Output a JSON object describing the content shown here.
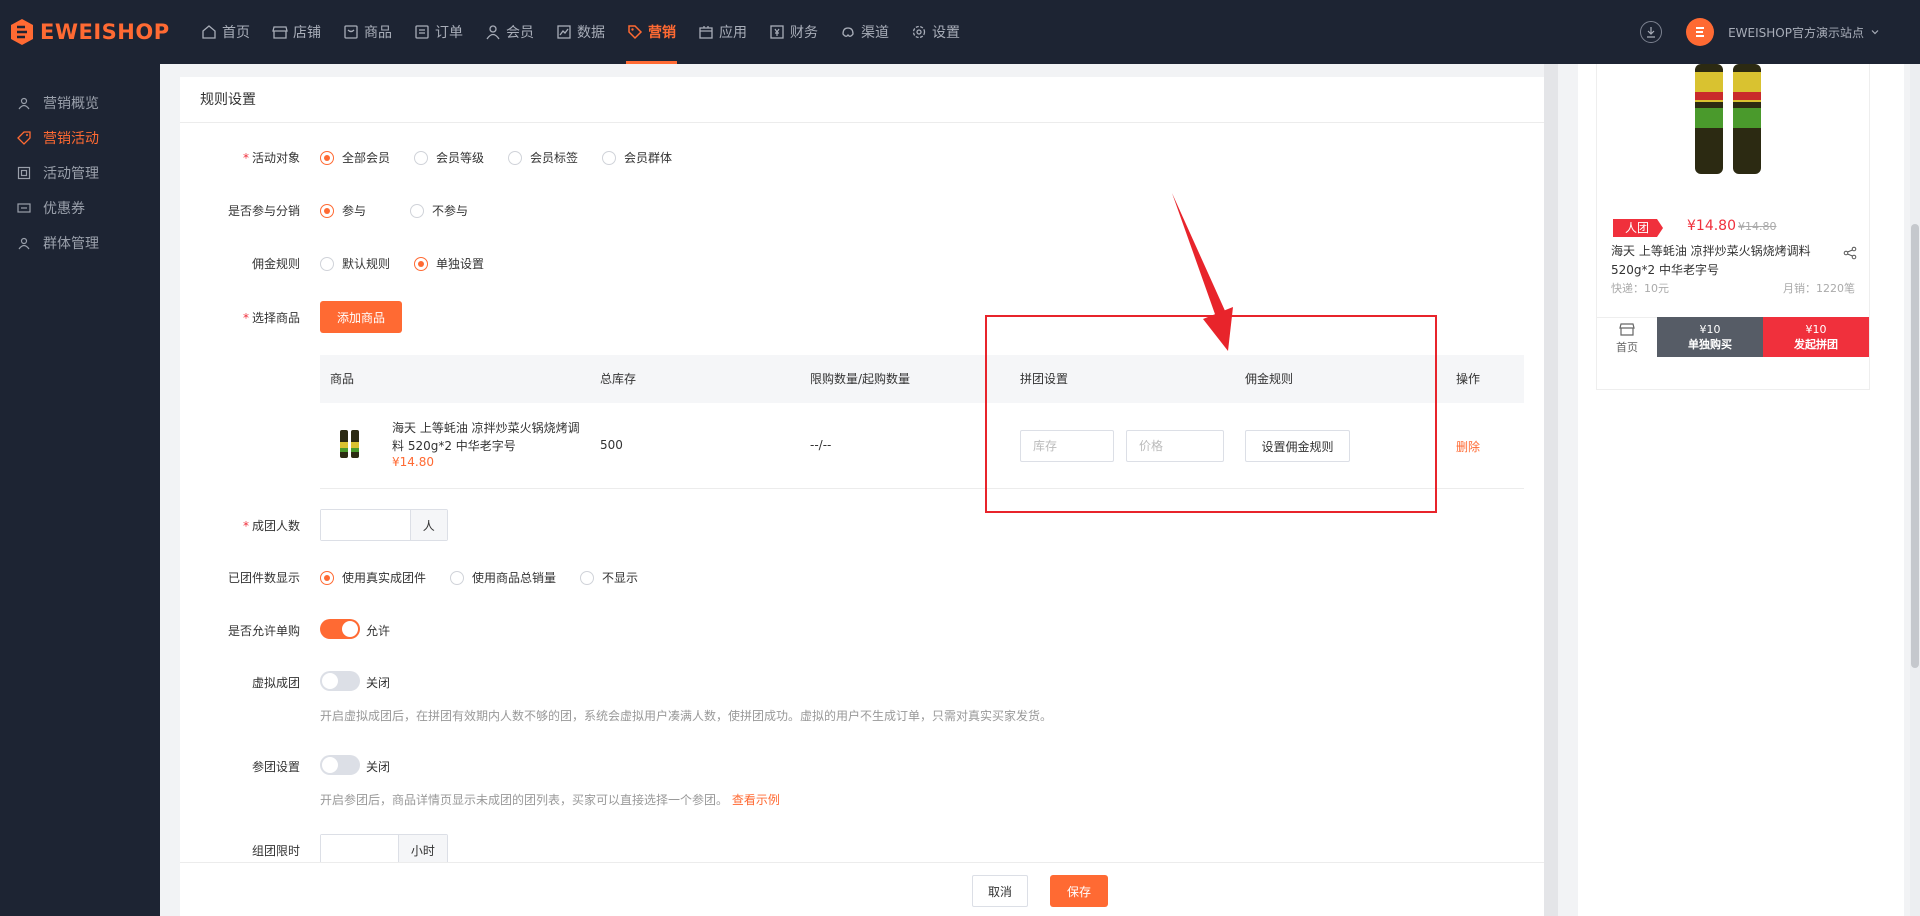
{
  "brand": {
    "name": "EWEISHOP",
    "accent": "#ff6a33"
  },
  "nav": [
    {
      "label": "首页",
      "icon": "home-icon"
    },
    {
      "label": "店铺",
      "icon": "store-icon"
    },
    {
      "label": "商品",
      "icon": "goods-icon"
    },
    {
      "label": "订单",
      "icon": "order-icon"
    },
    {
      "label": "会员",
      "icon": "member-icon"
    },
    {
      "label": "数据",
      "icon": "data-icon"
    },
    {
      "label": "营销",
      "icon": "tag-icon",
      "active": true
    },
    {
      "label": "应用",
      "icon": "app-icon"
    },
    {
      "label": "财务",
      "icon": "finance-icon"
    },
    {
      "label": "渠道",
      "icon": "channel-icon"
    },
    {
      "label": "设置",
      "icon": "gear-icon"
    }
  ],
  "account": {
    "store_name": "EWEISHOP官方演示站点"
  },
  "sidebar": [
    {
      "label": "营销概览",
      "icon": "overview-icon"
    },
    {
      "label": "营销活动",
      "icon": "tag-icon",
      "active": true
    },
    {
      "label": "活动管理",
      "icon": "manage-icon"
    },
    {
      "label": "优惠券",
      "icon": "coupon-icon"
    },
    {
      "label": "群体管理",
      "icon": "group-icon"
    }
  ],
  "form": {
    "title": "规则设置",
    "target": {
      "label": "活动对象",
      "options": [
        "全部会员",
        "会员等级",
        "会员标签",
        "会员群体"
      ],
      "selected": 0
    },
    "distribution": {
      "label": "是否参与分销",
      "options": [
        "参与",
        "不参与"
      ],
      "selected": 0
    },
    "commission": {
      "label": "佣金规则",
      "options": [
        "默认规则",
        "单独设置"
      ],
      "selected": 1
    },
    "goods": {
      "label": "选择商品",
      "add_button": "添加商品"
    },
    "table": {
      "headers": [
        "商品",
        "总库存",
        "限购数量/起购数量",
        "拼团设置",
        "佣金规则",
        "操作"
      ],
      "rows": [
        {
          "name": "海天 上等蚝油 凉拌炒菜火锅烧烤调料 520g*2 中华老字号",
          "price": "¥14.80",
          "stock": "500",
          "limit": "--/--",
          "stock_placeholder": "库存",
          "price_placeholder": "价格",
          "commission_button": "设置佣金规则",
          "action": "删除"
        }
      ]
    },
    "group_size": {
      "label": "成团人数",
      "unit": "人"
    },
    "group_count_display": {
      "label": "已团件数显示",
      "options": [
        "使用真实成团件",
        "使用商品总销量",
        "不显示"
      ],
      "selected": 0
    },
    "allow_single": {
      "label": "是否允许单购",
      "state": "允许",
      "on": true
    },
    "virtual_group": {
      "label": "虚拟成团",
      "state": "关闭",
      "on": false,
      "hint": "开启虚拟成团后，在拼团有效期内人数不够的团，系统会虚拟用户凑满人数，使拼团成功。虚拟的用户不生成订单，只需对真实买家发货。"
    },
    "join_group": {
      "label": "参团设置",
      "state": "关闭",
      "on": false,
      "hint": "开启参团后，商品详情页显示未成团的团列表，买家可以直接选择一个参团。",
      "link": "查看示例"
    },
    "time_limit": {
      "label": "组团限时",
      "unit": "小时"
    }
  },
  "footer": {
    "cancel": "取消",
    "save": "保存"
  },
  "preview": {
    "badge": "人团",
    "price": "¥14.80",
    "original_price": "¥14.80",
    "title": "海天 上等蚝油 凉拌炒菜火锅烧烤调料 520g*2 中华老字号",
    "shipping": "快递：10元",
    "sales": "月销：1220笔",
    "home": "首页",
    "solo_price": "¥10",
    "solo_label": "单独购买",
    "launch_price": "¥10",
    "launch_label": "发起拼团"
  }
}
